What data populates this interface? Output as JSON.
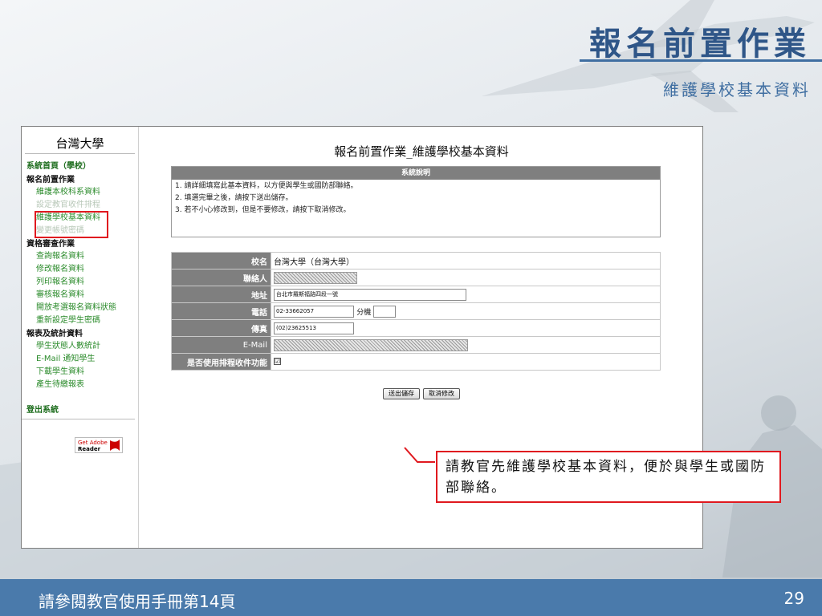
{
  "slide": {
    "title": "報名前置作業",
    "subtitle": "維護學校基本資料",
    "footer_note": "請參閱教官使用手冊第14頁",
    "page_number": "29",
    "callout_text": "請教官先維護學校基本資料，便於與學生或國防部聯絡。"
  },
  "sidebar": {
    "school": "台灣大學",
    "home": "系統首頁（學校）",
    "sections": [
      {
        "title": "報名前置作業",
        "items": [
          "維護本校科系資料",
          "設定教官收件排程",
          "維護學校基本資料",
          "變更帳號密碼"
        ]
      },
      {
        "title": "資格審查作業",
        "items": [
          "查詢報名資料",
          "修改報名資料",
          "列印報名資料",
          "審核報名資料",
          "開放考選報名資料狀態",
          "重新設定學生密碼"
        ]
      },
      {
        "title": "報表及統計資料",
        "items": [
          "學生狀態人數統計",
          "E-Mail 通知學生",
          "下載學生資料",
          "產生待繳報表"
        ]
      }
    ],
    "logout": "登出系統",
    "adobe_get": "Get Adobe",
    "adobe_reader": "Reader"
  },
  "main": {
    "page_title": "報名前置作業_維護學校基本資料",
    "info_header": "系統說明",
    "info_lines": [
      "1. 請詳細填寫此基本資料，以方便與學生或國防部聯絡。",
      "2. 填選完畢之後，請按下送出儲存。",
      "3. 若不小心修改到，但是不要修改，請按下取消修改。"
    ],
    "form": {
      "school_label": "校名",
      "school_value": "台灣大學（台灣大學）",
      "contact_label": "聯絡人",
      "address_label": "地址",
      "address_value": "台北市羅斯福路四段一號",
      "phone_label": "電話",
      "phone_value": "02-33662057",
      "ext_label": "分機",
      "fax_label": "傳真",
      "fax_value": "(02)23625513",
      "email_label": "E-Mail",
      "schedule_label": "是否使用排程收件功能",
      "schedule_checked": "☑"
    },
    "submit_label": "送出儲存",
    "cancel_label": "取消修改"
  },
  "colors": {
    "title_blue": "#2f5688",
    "footer_blue": "#4a7aab",
    "highlight_red": "#e0191f",
    "sidebar_green": "#2b8b2b",
    "label_gray": "#7f7f7f"
  }
}
